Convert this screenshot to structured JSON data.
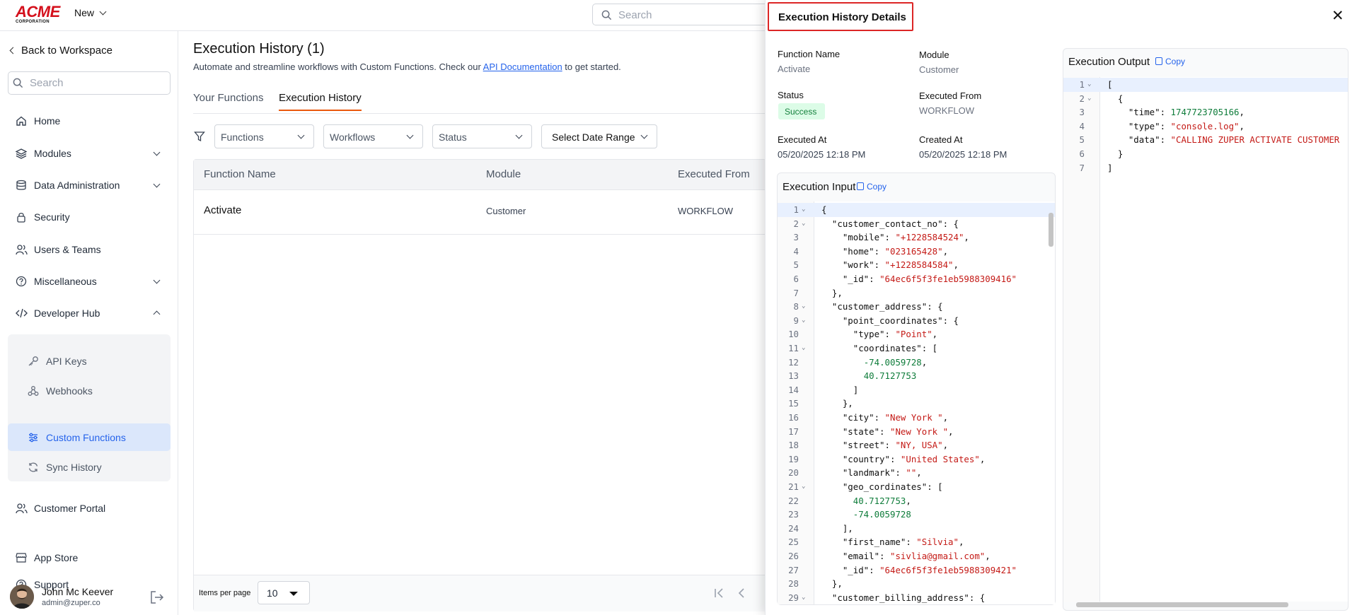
{
  "topbar": {
    "logo_top": "ACME",
    "logo_bottom": "CORPORATION",
    "new_label": "New",
    "search_placeholder": "Search"
  },
  "sidebar": {
    "back_label": "Back to Workspace",
    "search_placeholder": "Search",
    "items": [
      {
        "label": "Home",
        "icon": "home-icon"
      },
      {
        "label": "Modules",
        "icon": "layers-icon"
      },
      {
        "label": "Data Administration",
        "icon": "database-icon"
      },
      {
        "label": "Security",
        "icon": "lock-icon"
      },
      {
        "label": "Users & Teams",
        "icon": "users-icon"
      },
      {
        "label": "Miscellaneous",
        "icon": "help-circle-icon"
      },
      {
        "label": "Developer Hub",
        "icon": "code-icon"
      }
    ],
    "sub_items": [
      {
        "label": "API Keys",
        "icon": "key-icon"
      },
      {
        "label": "Webhooks",
        "icon": "webhook-icon"
      },
      {
        "label": "Custom Functions",
        "icon": "sliders-icon"
      },
      {
        "label": "Sync History",
        "icon": "sync-icon"
      }
    ],
    "bottom_items": [
      {
        "label": "Customer Portal",
        "icon": "users-icon"
      },
      {
        "label": "App Store",
        "icon": "store-icon"
      },
      {
        "label": "Support",
        "icon": "help-circle-icon"
      }
    ],
    "user": {
      "name": "John Mc Keever",
      "email": "admin@zuper.co"
    }
  },
  "main": {
    "title": "Execution History (1)",
    "subtitle_pre": "Automate and streamline workflows with Custom Functions. Check our ",
    "subtitle_link": "API Documentation",
    "subtitle_post": " to get started.",
    "tabs": [
      "Your Functions",
      "Execution History"
    ],
    "filters": [
      "Functions",
      "Workflows",
      "Status",
      "Select Date Range"
    ],
    "columns": [
      "Function Name",
      "Module",
      "Executed From"
    ],
    "rows": [
      {
        "function_name": "Activate",
        "module": "Customer",
        "executed_from": "WORKFLOW"
      }
    ],
    "items_per_page_label": "Items per page",
    "items_per_page": "10"
  },
  "panel": {
    "title": "Execution History Details",
    "close": "✕",
    "function_name_label": "Function Name",
    "function_name": "Activate",
    "module_label": "Module",
    "module": "Customer",
    "status_label": "Status",
    "status": "Success",
    "executed_from_label": "Executed From",
    "executed_from": "WORKFLOW",
    "executed_at_label": "Executed At",
    "executed_at": "05/20/2025 12:18 PM",
    "created_at_label": "Created At",
    "created_at": "05/20/2025 12:18 PM",
    "input_label": "Execution Input",
    "output_label": "Execution Output",
    "copy_label": "Copy",
    "colors": {
      "string": "#c41a16",
      "number": "#0e7c3a",
      "accent": "#2563eb",
      "highlight_border": "#dc2626"
    },
    "input_lines": [
      [
        {
          "t": "{",
          "c": "k"
        }
      ],
      [
        {
          "t": "  ",
          "c": "k"
        },
        {
          "t": "\"customer_contact_no\"",
          "c": "k"
        },
        {
          "t": ": {",
          "c": "k"
        }
      ],
      [
        {
          "t": "    \"mobile\": ",
          "c": "k"
        },
        {
          "t": "\"+1228584524\"",
          "c": "s"
        },
        {
          "t": ",",
          "c": "k"
        }
      ],
      [
        {
          "t": "    \"home\": ",
          "c": "k"
        },
        {
          "t": "\"023165428\"",
          "c": "s"
        },
        {
          "t": ",",
          "c": "k"
        }
      ],
      [
        {
          "t": "    \"work\": ",
          "c": "k"
        },
        {
          "t": "\"+1228584584\"",
          "c": "s"
        },
        {
          "t": ",",
          "c": "k"
        }
      ],
      [
        {
          "t": "    \"_id\": ",
          "c": "k"
        },
        {
          "t": "\"64ec6f5f3fe1eb5988309416\"",
          "c": "s"
        }
      ],
      [
        {
          "t": "  },",
          "c": "k"
        }
      ],
      [
        {
          "t": "  \"customer_address\": {",
          "c": "k"
        }
      ],
      [
        {
          "t": "    \"point_coordinates\": {",
          "c": "k"
        }
      ],
      [
        {
          "t": "      \"type\": ",
          "c": "k"
        },
        {
          "t": "\"Point\"",
          "c": "s"
        },
        {
          "t": ",",
          "c": "k"
        }
      ],
      [
        {
          "t": "      \"coordinates\": [",
          "c": "k"
        }
      ],
      [
        {
          "t": "        ",
          "c": "k"
        },
        {
          "t": "-74.0059728",
          "c": "n"
        },
        {
          "t": ",",
          "c": "k"
        }
      ],
      [
        {
          "t": "        ",
          "c": "k"
        },
        {
          "t": "40.7127753",
          "c": "n"
        }
      ],
      [
        {
          "t": "      ]",
          "c": "k"
        }
      ],
      [
        {
          "t": "    },",
          "c": "k"
        }
      ],
      [
        {
          "t": "    \"city\": ",
          "c": "k"
        },
        {
          "t": "\"New York \"",
          "c": "s"
        },
        {
          "t": ",",
          "c": "k"
        }
      ],
      [
        {
          "t": "    \"state\": ",
          "c": "k"
        },
        {
          "t": "\"New York \"",
          "c": "s"
        },
        {
          "t": ",",
          "c": "k"
        }
      ],
      [
        {
          "t": "    \"street\": ",
          "c": "k"
        },
        {
          "t": "\"NY, USA\"",
          "c": "s"
        },
        {
          "t": ",",
          "c": "k"
        }
      ],
      [
        {
          "t": "    \"country\": ",
          "c": "k"
        },
        {
          "t": "\"United States\"",
          "c": "s"
        },
        {
          "t": ",",
          "c": "k"
        }
      ],
      [
        {
          "t": "    \"landmark\": ",
          "c": "k"
        },
        {
          "t": "\"\"",
          "c": "s"
        },
        {
          "t": ",",
          "c": "k"
        }
      ],
      [
        {
          "t": "    \"geo_cordinates\": [",
          "c": "k"
        }
      ],
      [
        {
          "t": "      ",
          "c": "k"
        },
        {
          "t": "40.7127753",
          "c": "n"
        },
        {
          "t": ",",
          "c": "k"
        }
      ],
      [
        {
          "t": "      ",
          "c": "k"
        },
        {
          "t": "-74.0059728",
          "c": "n"
        }
      ],
      [
        {
          "t": "    ],",
          "c": "k"
        }
      ],
      [
        {
          "t": "    \"first_name\": ",
          "c": "k"
        },
        {
          "t": "\"Silvia\"",
          "c": "s"
        },
        {
          "t": ",",
          "c": "k"
        }
      ],
      [
        {
          "t": "    \"email\": ",
          "c": "k"
        },
        {
          "t": "\"sivlia@gmail.com\"",
          "c": "s"
        },
        {
          "t": ",",
          "c": "k"
        }
      ],
      [
        {
          "t": "    \"_id\": ",
          "c": "k"
        },
        {
          "t": "\"64ec6f5f3fe1eb5988309421\"",
          "c": "s"
        }
      ],
      [
        {
          "t": "  },",
          "c": "k"
        }
      ],
      [
        {
          "t": "  \"customer_billing_address\": {",
          "c": "k"
        }
      ]
    ],
    "input_folds": [
      1,
      2,
      8,
      9,
      11,
      21,
      29
    ],
    "output_lines": [
      [
        {
          "t": "[",
          "c": "k"
        }
      ],
      [
        {
          "t": "  {",
          "c": "k"
        }
      ],
      [
        {
          "t": "    \"time\": ",
          "c": "k"
        },
        {
          "t": "1747723705166",
          "c": "n"
        },
        {
          "t": ",",
          "c": "k"
        }
      ],
      [
        {
          "t": "    \"type\": ",
          "c": "k"
        },
        {
          "t": "\"console.log\"",
          "c": "s"
        },
        {
          "t": ",",
          "c": "k"
        }
      ],
      [
        {
          "t": "    \"data\": ",
          "c": "k"
        },
        {
          "t": "\"CALLING ZUPER ACTIVATE CUSTOMER",
          "c": "s"
        }
      ],
      [
        {
          "t": "  }",
          "c": "k"
        }
      ],
      [
        {
          "t": "]",
          "c": "k"
        }
      ]
    ],
    "output_folds": [
      1,
      2
    ]
  }
}
